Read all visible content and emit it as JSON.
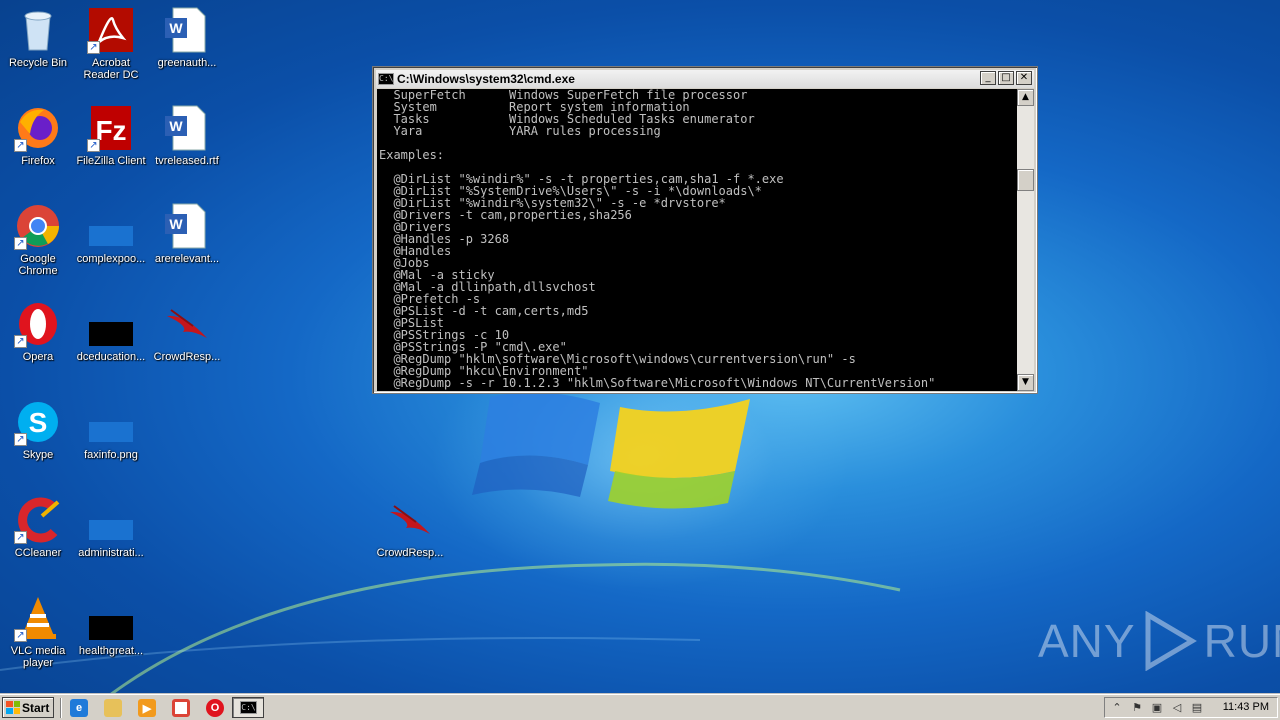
{
  "desktop": {
    "icons": [
      {
        "label": "Recycle Bin",
        "icon": "recycle-bin-icon"
      },
      {
        "label": "Acrobat Reader DC",
        "icon": "acrobat-icon"
      },
      {
        "label": "greenauth...",
        "icon": "word-doc-icon"
      },
      {
        "label": "Firefox",
        "icon": "firefox-icon"
      },
      {
        "label": "FileZilla Client",
        "icon": "filezilla-icon"
      },
      {
        "label": "tvreleased.rtf",
        "icon": "word-doc-icon"
      },
      {
        "label": "Google Chrome",
        "icon": "chrome-icon"
      },
      {
        "label": "complexpoo...",
        "icon": "blank-file-icon"
      },
      {
        "label": "arerelevant...",
        "icon": "word-doc-icon"
      },
      {
        "label": "Opera",
        "icon": "opera-icon"
      },
      {
        "label": "dceducation...",
        "icon": "black-file-icon"
      },
      {
        "label": "CrowdResp...",
        "icon": "crowdresponse-icon"
      },
      {
        "label": "Skype",
        "icon": "skype-icon"
      },
      {
        "label": "faxinfo.png",
        "icon": "blank-file-icon"
      },
      {
        "label": "CCleaner",
        "icon": "ccleaner-icon"
      },
      {
        "label": "administrati...",
        "icon": "blank-file-icon"
      },
      {
        "label": "CrowdResp...",
        "icon": "crowdresponse-icon"
      },
      {
        "label": "VLC media player",
        "icon": "vlc-icon"
      },
      {
        "label": "healthgreat...",
        "icon": "black-file-icon"
      }
    ]
  },
  "cmd_window": {
    "title": "C:\\Windows\\system32\\cmd.exe",
    "title_icon_text": "C:\\",
    "buttons": {
      "minimize": "_",
      "maximize": "□",
      "close": "✕"
    },
    "scroll_up": "▲",
    "scroll_down": "▼",
    "lines": [
      "  SuperFetch      Windows SuperFetch file processor",
      "  System          Report system information",
      "  Tasks           Windows Scheduled Tasks enumerator",
      "  Yara            YARA rules processing",
      "",
      "Examples:",
      "",
      "  @DirList \"%windir%\" -s -t properties,cam,sha1 -f *.exe",
      "  @DirList \"%SystemDrive%\\Users\\\" -s -i *\\downloads\\*",
      "  @DirList \"%windir%\\system32\\\" -s -e *drvstore*",
      "  @Drivers -t cam,properties,sha256",
      "  @Drivers",
      "  @Handles -p 3268",
      "  @Handles",
      "  @Jobs",
      "  @Mal -a sticky",
      "  @Mal -a dllinpath,dllsvchost",
      "  @Prefetch -s",
      "  @PSList -d -t cam,certs,md5",
      "  @PSList",
      "  @PSStrings -c 10",
      "  @PSStrings -P \"cmd\\.exe\"",
      "  @RegDump \"hklm\\software\\Microsoft\\windows\\currentversion\\run\" -s",
      "  @RegDump \"hkcu\\Environment\"",
      "  @RegDump -s -r 10.1.2.3 \"hklm\\Software\\Microsoft\\Windows NT\\CurrentVersion\""
    ]
  },
  "watermark": {
    "left": "ANY",
    "right": "RUN"
  },
  "taskbar": {
    "start_label": "Start",
    "quick_launch": [
      "ie-icon",
      "explorer-icon",
      "media-player-icon",
      "chrome-icon",
      "opera-icon"
    ],
    "active_task_icon_text": "C:\\",
    "tray_icons": [
      "chevron-up-icon",
      "flag-icon",
      "network-icon",
      "volume-icon",
      "keyboard-icon"
    ],
    "tray_glyphs": {
      "chevron": "⌃",
      "flag": "⚑",
      "network": "▣",
      "volume": "◁",
      "keyboard": "▤"
    },
    "clock": "11:43 PM"
  }
}
